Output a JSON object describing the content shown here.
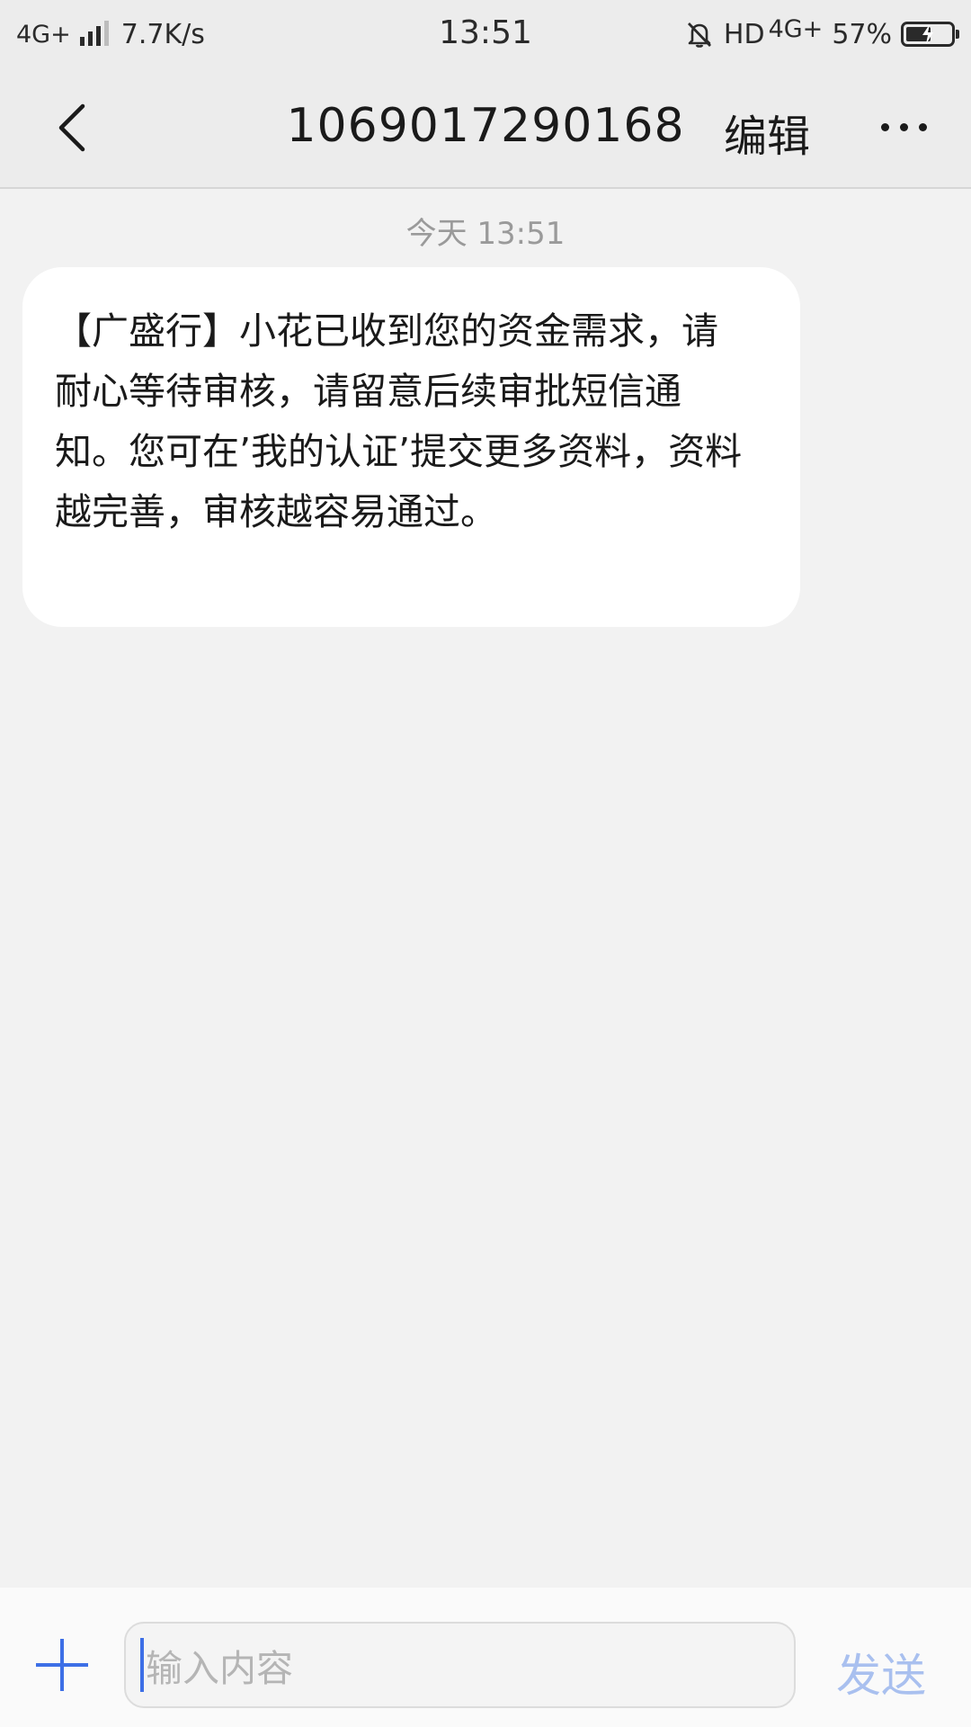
{
  "status_bar": {
    "network_type": "4G+",
    "signal_icon": "signal-bars-icon",
    "speed": "7.7K/s",
    "time": "13:51",
    "mute_icon": "bell-off-icon",
    "hd": "HD",
    "network_type_2": "4G+",
    "battery_percent": "57%",
    "battery_level": 0.57,
    "battery_icon": "battery-charging-icon"
  },
  "header": {
    "back_icon": "chevron-left-icon",
    "title": "1069017290168",
    "edit_label": "编辑",
    "more_icon": "more-horizontal-icon"
  },
  "conversation": {
    "timestamp": "今天 13:51",
    "messages": [
      {
        "direction": "incoming",
        "text": "【广盛行】小花已收到您的资金需求，请耐心等待审核，请留意后续审批短信通知。您可在’我的认证’提交更多资料，资料越完善，审核越容易通过。"
      }
    ]
  },
  "composer": {
    "add_icon": "plus-icon",
    "placeholder": "输入内容",
    "send_label": "发送"
  },
  "colors": {
    "accent": "#3d6fe6",
    "send_disabled": "#a9c0ef",
    "background": "#f2f2f2",
    "bubble": "#ffffff"
  }
}
